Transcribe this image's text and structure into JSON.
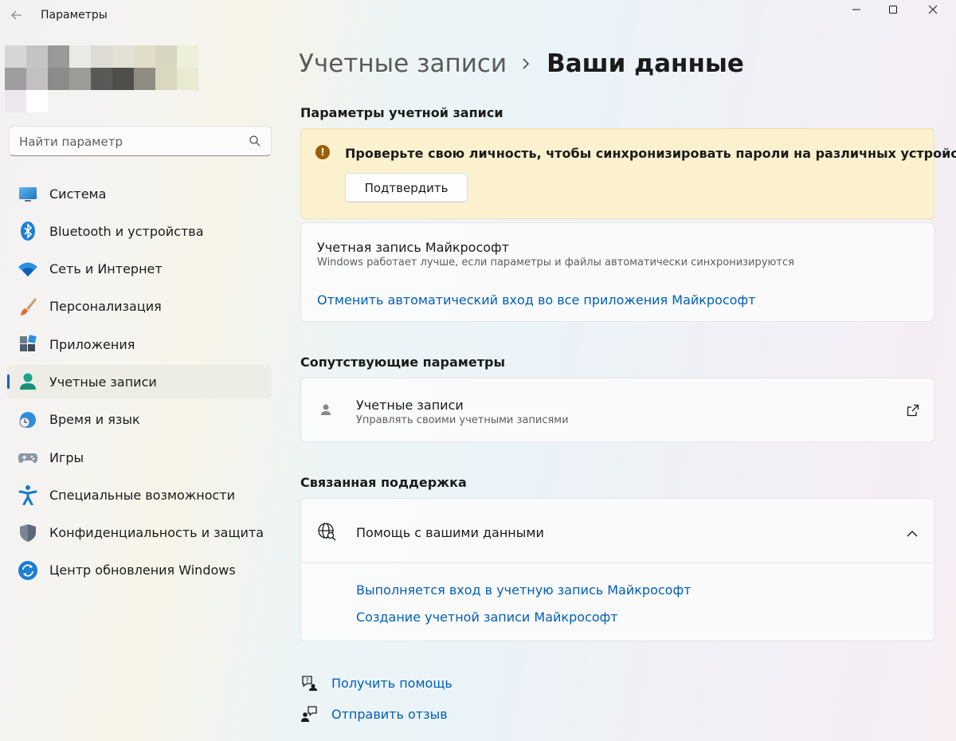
{
  "app": {
    "title": "Параметры"
  },
  "search": {
    "placeholder": "Найти параметр"
  },
  "sidebar": {
    "items": [
      {
        "label": "Система",
        "icon": "monitor-icon"
      },
      {
        "label": "Bluetooth и устройства",
        "icon": "bluetooth-icon"
      },
      {
        "label": "Сеть и Интернет",
        "icon": "wifi-icon"
      },
      {
        "label": "Персонализация",
        "icon": "brush-icon"
      },
      {
        "label": "Приложения",
        "icon": "apps-icon"
      },
      {
        "label": "Учетные записи",
        "icon": "user-icon",
        "active": true
      },
      {
        "label": "Время и язык",
        "icon": "clock-globe-icon"
      },
      {
        "label": "Игры",
        "icon": "gamepad-icon"
      },
      {
        "label": "Специальные возможности",
        "icon": "accessibility-icon"
      },
      {
        "label": "Конфиденциальность и защита",
        "icon": "shield-icon"
      },
      {
        "label": "Центр обновления Windows",
        "icon": "update-icon"
      }
    ]
  },
  "breadcrumb": {
    "parent": "Учетные записи",
    "current": "Ваши данные"
  },
  "account_settings": {
    "title": "Параметры учетной записи",
    "warning_text": "Проверьте свою личность, чтобы синхронизировать пароли на различных устройствах.",
    "confirm_label": "Подтвердить",
    "ms_account_title": "Учетная запись Майкрософт",
    "ms_account_desc": "Windows работает лучше, если параметры и файлы автоматически синхронизируются",
    "ms_account_link": "Отменить автоматический вход во все приложения Майкрософт"
  },
  "related_settings": {
    "title": "Сопутствующие параметры",
    "accounts_title": "Учетные записи",
    "accounts_desc": "Управлять своими учетными записями"
  },
  "related_support": {
    "title": "Связанная поддержка",
    "help_title": "Помощь с вашими данными",
    "links": [
      "Выполняется вход в учетную запись Майкрософт",
      "Создание учетной записи Майкрософт"
    ]
  },
  "footer": {
    "get_help": "Получить помощь",
    "send_feedback": "Отправить отзыв"
  },
  "colors": {
    "accent": "#0067c0",
    "link": "#005fb8",
    "warning_bg": "#fbf1cf",
    "warning_icon": "#9d5d00"
  }
}
